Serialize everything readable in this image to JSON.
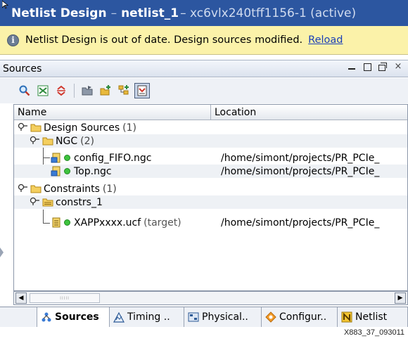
{
  "window": {
    "title_main": "Netlist Design",
    "title_sep": "–",
    "title_file": "netlist_1",
    "title_device": "– xc6vlx240tff1156-1 (active)"
  },
  "banner": {
    "message": "Netlist Design is out of date. Design sources modified.",
    "link": "Reload",
    "icon": "info-icon"
  },
  "panel": {
    "title": "Sources",
    "controls": {
      "close": "×"
    }
  },
  "toolbar": {
    "buttons": [
      "search-icon",
      "collapse-all-icon",
      "expand-all-icon",
      "open-file-icon",
      "add-sources-icon",
      "hierarchy-update-icon",
      "show-files-icon"
    ]
  },
  "table": {
    "columns": [
      "Name",
      "Location"
    ],
    "rows": [
      {
        "name": "Design Sources",
        "count": "(1)",
        "location": ""
      },
      {
        "name": "NGC",
        "count": "(2)",
        "location": ""
      },
      {
        "name": "config_FIFO.ngc",
        "location": "/home/simont/projects/PR_PCIe_"
      },
      {
        "name": "Top.ngc",
        "location": "/home/simont/projects/PR_PCIe_"
      },
      {
        "name": "Constraints",
        "count": "(1)",
        "location": ""
      },
      {
        "name": "constrs_1",
        "location": ""
      },
      {
        "name": "XAPPxxxx.ucf",
        "tag": "(target)",
        "location": "/home/simont/projects/PR_PCIe_"
      }
    ]
  },
  "tabs": [
    {
      "label": "Sources",
      "icon": "sources-tab-icon",
      "active": true
    },
    {
      "label": "Timing ..",
      "icon": "timing-tab-icon"
    },
    {
      "label": "Physical..",
      "icon": "physical-tab-icon"
    },
    {
      "label": "Configur..",
      "icon": "configuration-tab-icon"
    },
    {
      "label": "Netlist",
      "icon": "netlist-tab-icon"
    }
  ],
  "figure_code": "X883_37_093011",
  "colors": {
    "title_bar": "#2c56a0",
    "banner": "#fbf2a9",
    "link": "#1a3fb7",
    "status_dot": "#3ec33e",
    "folder": "#e8b93c"
  }
}
